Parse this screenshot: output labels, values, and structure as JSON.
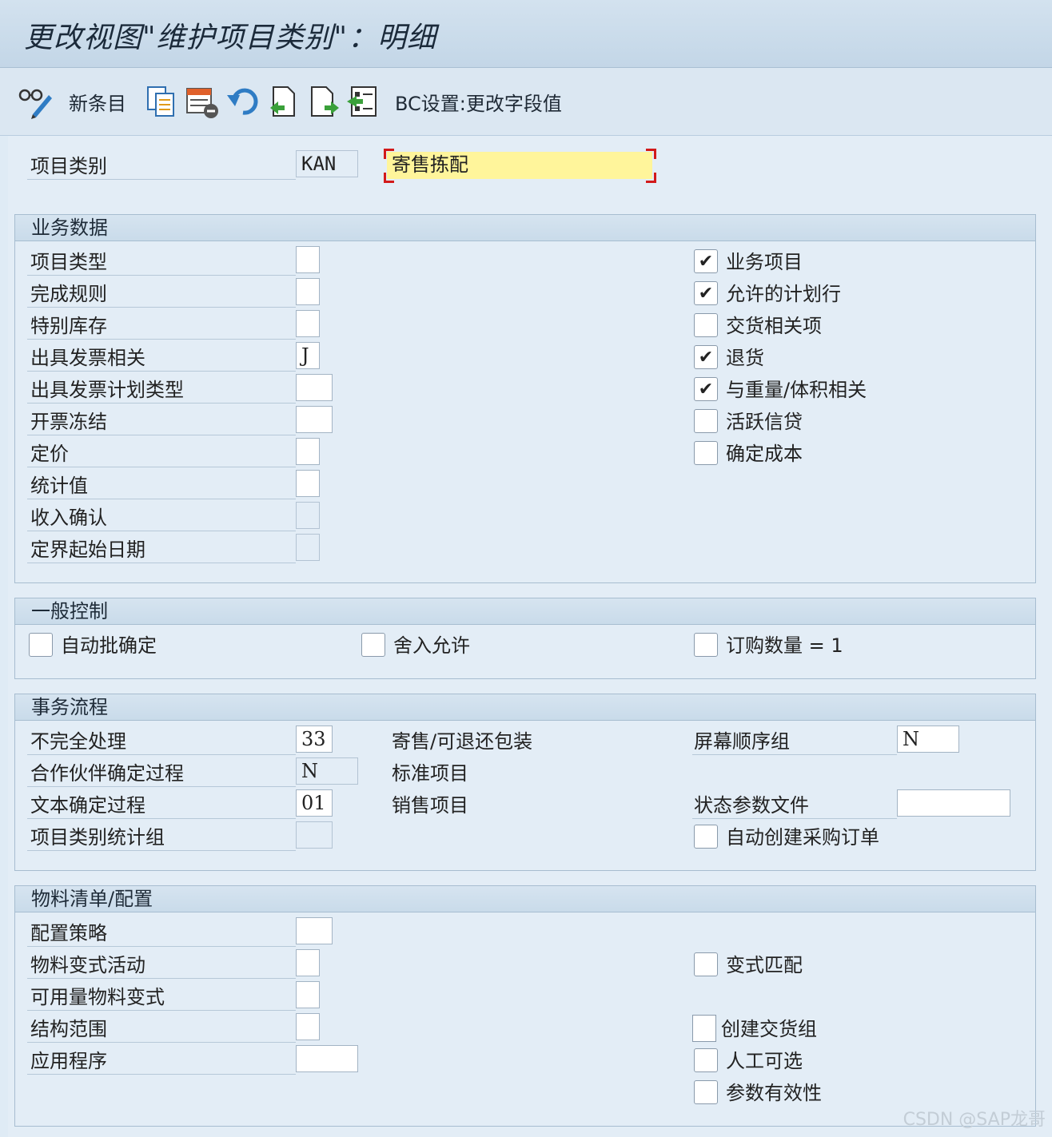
{
  "title": "更改视图\"维护项目类别\"：明细",
  "toolbar": {
    "new_entries_label": "新条目",
    "bc_label": "BC设置:更改字段值",
    "icons": [
      "glasses-pencil-icon",
      "copy-icon",
      "delete-icon",
      "undo-icon",
      "previous-entry-icon",
      "next-entry-icon",
      "select-icon"
    ]
  },
  "header": {
    "label": "项目类别",
    "code": "KAN",
    "description": "寄售拣配"
  },
  "sections": {
    "business": {
      "title": "业务数据",
      "fields": [
        {
          "label": "项目类型",
          "value": ""
        },
        {
          "label": "完成规则",
          "value": ""
        },
        {
          "label": "特别库存",
          "value": ""
        },
        {
          "label": "出具发票相关",
          "value": "J"
        },
        {
          "label": "出具发票计划类型",
          "value": ""
        },
        {
          "label": "开票冻结",
          "value": ""
        },
        {
          "label": "定价",
          "value": ""
        },
        {
          "label": "统计值",
          "value": ""
        },
        {
          "label": "收入确认",
          "value": ""
        },
        {
          "label": "定界起始日期",
          "value": ""
        }
      ],
      "checks": [
        {
          "label": "业务项目",
          "checked": "✔"
        },
        {
          "label": "允许的计划行",
          "checked": "✔"
        },
        {
          "label": "交货相关项",
          "checked": ""
        },
        {
          "label": "退货",
          "checked": "✔"
        },
        {
          "label": "与重量/体积相关",
          "checked": "✔"
        },
        {
          "label": "活跃信贷",
          "checked": ""
        },
        {
          "label": "确定成本",
          "checked": ""
        }
      ]
    },
    "general": {
      "title": "一般控制",
      "checks": [
        {
          "label": "自动批确定",
          "checked": ""
        },
        {
          "label": "舍入允许",
          "checked": ""
        },
        {
          "label": "订购数量 = 1",
          "checked": ""
        }
      ]
    },
    "flow": {
      "title": "事务流程",
      "fields": [
        {
          "label": "不完全处理",
          "value": "33",
          "note": "寄售/可退还包装"
        },
        {
          "label": "合作伙伴确定过程",
          "value": "N",
          "note": "标准项目"
        },
        {
          "label": "文本确定过程",
          "value": "01",
          "note": "销售项目"
        },
        {
          "label": "项目类别统计组",
          "value": "",
          "note": ""
        }
      ],
      "right": {
        "screen_seq_label": "屏幕顺序组",
        "screen_seq_value": "N",
        "status_profile_label": "状态参数文件",
        "status_profile_value": "",
        "auto_po_label": "自动创建采购订单",
        "auto_po_checked": ""
      }
    },
    "bom": {
      "title": "物料清单/配置",
      "fields": [
        {
          "label": "配置策略",
          "value": ""
        },
        {
          "label": "物料变式活动",
          "value": ""
        },
        {
          "label": "可用量物料变式",
          "value": ""
        },
        {
          "label": "结构范围",
          "value": ""
        },
        {
          "label": "应用程序",
          "value": ""
        }
      ],
      "checks": [
        {
          "label": "变式匹配",
          "checked": ""
        },
        {
          "label": "创建交货组",
          "checked": ""
        },
        {
          "label": "人工可选",
          "checked": ""
        },
        {
          "label": "参数有效性",
          "checked": ""
        }
      ]
    }
  },
  "watermark": "CSDN @SAP龙哥"
}
